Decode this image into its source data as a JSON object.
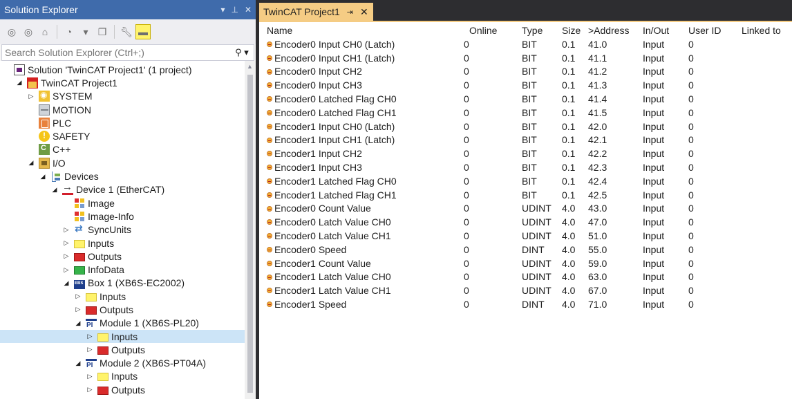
{
  "solution_explorer": {
    "title": "Solution Explorer",
    "window_controls": {
      "dropdown": "▾",
      "pin": "⊥",
      "close": "✕"
    },
    "search": {
      "placeholder": "Search Solution Explorer (Ctrl+;)"
    },
    "tree": [
      {
        "label": "Solution 'TwinCAT Project1' (1 project)",
        "icon": "solution-icon",
        "indent": 0,
        "twisty": ""
      },
      {
        "label": "TwinCAT Project1",
        "icon": "project-icon",
        "indent": 1,
        "twisty": "expanded"
      },
      {
        "label": "SYSTEM",
        "icon": "system-icon",
        "indent": 2,
        "twisty": "collapsed"
      },
      {
        "label": "MOTION",
        "icon": "motion-icon",
        "indent": 2,
        "twisty": ""
      },
      {
        "label": "PLC",
        "icon": "plc-icon",
        "indent": 2,
        "twisty": ""
      },
      {
        "label": "SAFETY",
        "icon": "safety-icon",
        "indent": 2,
        "twisty": ""
      },
      {
        "label": "C++",
        "icon": "cpp-icon",
        "indent": 2,
        "twisty": ""
      },
      {
        "label": "I/O",
        "icon": "io-icon",
        "indent": 2,
        "twisty": "expanded"
      },
      {
        "label": "Devices",
        "icon": "devices-icon",
        "indent": 3,
        "twisty": "expanded"
      },
      {
        "label": "Device 1 (EtherCAT)",
        "icon": "ethercat-device-icon",
        "indent": 4,
        "twisty": "expanded"
      },
      {
        "label": "Image",
        "icon": "image-icon",
        "indent": 5,
        "twisty": ""
      },
      {
        "label": "Image-Info",
        "icon": "image-info-icon",
        "indent": 5,
        "twisty": ""
      },
      {
        "label": "SyncUnits",
        "icon": "sync-units-icon",
        "indent": 5,
        "twisty": "collapsed"
      },
      {
        "label": "Inputs",
        "icon": "inputs-icon",
        "indent": 5,
        "twisty": "collapsed"
      },
      {
        "label": "Outputs",
        "icon": "outputs-icon",
        "indent": 5,
        "twisty": "collapsed"
      },
      {
        "label": "InfoData",
        "icon": "infodata-icon",
        "indent": 5,
        "twisty": "collapsed"
      },
      {
        "label": "Box 1 (XB6S-EC2002)",
        "icon": "box-icon",
        "indent": 5,
        "twisty": "expanded"
      },
      {
        "label": "Inputs",
        "icon": "inputs-icon",
        "indent": 6,
        "twisty": "collapsed"
      },
      {
        "label": "Outputs",
        "icon": "outputs-icon",
        "indent": 6,
        "twisty": "collapsed"
      },
      {
        "label": "Module 1 (XB6S-PL20)",
        "icon": "module-icon",
        "indent": 6,
        "twisty": "expanded"
      },
      {
        "label": "Inputs",
        "icon": "inputs-icon",
        "indent": 7,
        "twisty": "collapsed",
        "selected": true
      },
      {
        "label": "Outputs",
        "icon": "outputs-icon",
        "indent": 7,
        "twisty": "collapsed"
      },
      {
        "label": "Module 2 (XB6S-PT04A)",
        "icon": "module-icon",
        "indent": 6,
        "twisty": "expanded"
      },
      {
        "label": "Inputs",
        "icon": "inputs-icon",
        "indent": 7,
        "twisty": "collapsed"
      },
      {
        "label": "Outputs",
        "icon": "outputs-icon",
        "indent": 7,
        "twisty": "collapsed"
      }
    ]
  },
  "document_tab": {
    "label": "TwinCAT Project1",
    "pin": "⇥",
    "close": "✕"
  },
  "table": {
    "columns": [
      "Name",
      "Online",
      "Type",
      "Size",
      ">Address",
      "In/Out",
      "User ID",
      "Linked to"
    ],
    "rows": [
      [
        "Encoder0 Input CH0 (Latch)",
        "0",
        "BIT",
        "0.1",
        "41.0",
        "Input",
        "0"
      ],
      [
        "Encoder0 Input CH1 (Latch)",
        "0",
        "BIT",
        "0.1",
        "41.1",
        "Input",
        "0"
      ],
      [
        "Encoder0 Input CH2",
        "0",
        "BIT",
        "0.1",
        "41.2",
        "Input",
        "0"
      ],
      [
        "Encoder0 Input CH3",
        "0",
        "BIT",
        "0.1",
        "41.3",
        "Input",
        "0"
      ],
      [
        "Encoder0 Latched Flag CH0",
        "0",
        "BIT",
        "0.1",
        "41.4",
        "Input",
        "0"
      ],
      [
        "Encoder0 Latched Flag CH1",
        "0",
        "BIT",
        "0.1",
        "41.5",
        "Input",
        "0"
      ],
      [
        "Encoder1 Input CH0 (Latch)",
        "0",
        "BIT",
        "0.1",
        "42.0",
        "Input",
        "0"
      ],
      [
        "Encoder1 Input CH1 (Latch)",
        "0",
        "BIT",
        "0.1",
        "42.1",
        "Input",
        "0"
      ],
      [
        "Encoder1 Input CH2",
        "0",
        "BIT",
        "0.1",
        "42.2",
        "Input",
        "0"
      ],
      [
        "Encoder1 Input CH3",
        "0",
        "BIT",
        "0.1",
        "42.3",
        "Input",
        "0"
      ],
      [
        "Encoder1 Latched Flag CH0",
        "0",
        "BIT",
        "0.1",
        "42.4",
        "Input",
        "0"
      ],
      [
        "Encoder1 Latched Flag CH1",
        "0",
        "BIT",
        "0.1",
        "42.5",
        "Input",
        "0"
      ],
      [
        "Encoder0 Count Value",
        "0",
        "UDINT",
        "4.0",
        "43.0",
        "Input",
        "0"
      ],
      [
        "Encoder0 Latch Value CH0",
        "0",
        "UDINT",
        "4.0",
        "47.0",
        "Input",
        "0"
      ],
      [
        "Encoder0 Latch Value CH1",
        "0",
        "UDINT",
        "4.0",
        "51.0",
        "Input",
        "0"
      ],
      [
        "Encoder0 Speed",
        "0",
        "DINT",
        "4.0",
        "55.0",
        "Input",
        "0"
      ],
      [
        "Encoder1 Count Value",
        "0",
        "UDINT",
        "4.0",
        "59.0",
        "Input",
        "0"
      ],
      [
        "Encoder1 Latch Value CH0",
        "0",
        "UDINT",
        "4.0",
        "63.0",
        "Input",
        "0"
      ],
      [
        "Encoder1 Latch Value CH1",
        "0",
        "UDINT",
        "4.0",
        "67.0",
        "Input",
        "0"
      ],
      [
        "Encoder1 Speed",
        "0",
        "DINT",
        "4.0",
        "71.0",
        "Input",
        "0"
      ]
    ]
  },
  "colors": {
    "title_bar": "#3f6bab",
    "tab_active": "#f5cc84",
    "selection": "#cce4f7"
  }
}
